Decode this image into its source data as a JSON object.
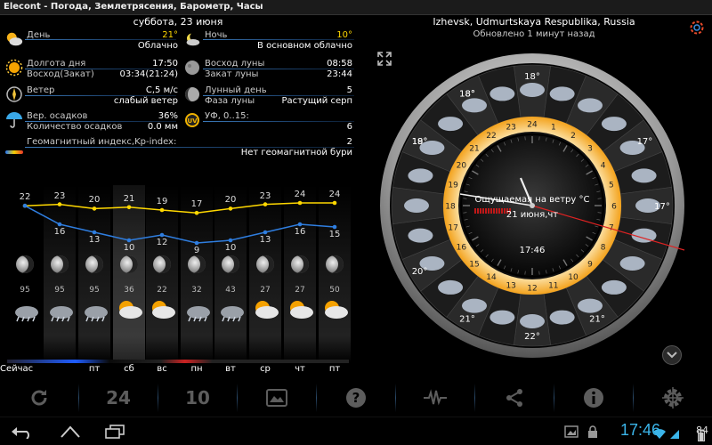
{
  "window": {
    "title": "Elecont - Погода, Землетрясения, Барометр, Часы"
  },
  "left": {
    "date": "суббота, 23 июня",
    "rows": [
      {
        "l_label": "День",
        "l_value": "21°",
        "l_sub": "Облачно",
        "r_label": "Ночь",
        "r_value": "10°",
        "r_sub": "В основном облачно"
      },
      {
        "l_label": "Долгота дня",
        "l_value": "17:50",
        "l_label2": "Восход(Закат)",
        "l_value2": "03:34(21:24)",
        "r_label": "Восход луны",
        "r_value": "08:58",
        "r_label2": "Закат луны",
        "r_value2": "23:44"
      },
      {
        "l_label": "Ветер",
        "l_value": "С,5 м/с",
        "l_sub": "слабый ветер",
        "r_label": "Лунный день",
        "r_value": "5",
        "r_label2": "Фаза луны",
        "r_value2": "Растущий серп"
      },
      {
        "l_label": "Вер. осадков",
        "l_value": "36%",
        "l_label2": "Количество осадков",
        "l_value2": "0.0 мм",
        "r_label": "УФ, 0..15:",
        "r_value2": "6"
      },
      {
        "l_label": "Геомагнитный индекс,Kp-index:",
        "l_value": "2",
        "l_sub": "Нет геомагнитной бури"
      }
    ]
  },
  "forecast": {
    "days": [
      "Сейчас",
      "",
      "пт",
      "сб",
      "вс",
      "пн",
      "вт",
      "ср",
      "чт",
      "пт"
    ],
    "highs": [
      "22",
      "23",
      "20",
      "21",
      "19",
      "17",
      "20",
      "23",
      "24",
      "24"
    ],
    "lows": [
      "",
      "16",
      "13",
      "10",
      "12",
      "9",
      "10",
      "13",
      "16",
      "15"
    ],
    "precip": [
      "95",
      "95",
      "95",
      "36",
      "22",
      "32",
      "43",
      "27",
      "27",
      "50"
    ],
    "icons": [
      "storm-cloud-icon",
      "storm-cloud-icon",
      "storm-cloud-icon",
      "sun-cloud-icon",
      "sun-cloud-icon",
      "storm-cloud-icon",
      "storm-cloud-icon",
      "sun-cloud-icon",
      "sun-cloud-icon",
      "sun-cloud-icon"
    ]
  },
  "right": {
    "location": "Izhevsk, Udmurtskaya Respublika, Russia",
    "updated": "Обновлено 1 минут назад",
    "dial": {
      "center_label": "Ощущаемая на ветру °C",
      "center_date": "21 июня,чт",
      "center_time": "17:46",
      "hours": [
        "24",
        "1",
        "2",
        "3",
        "4",
        "5",
        "6",
        "7",
        "8",
        "9",
        "10",
        "11",
        "12",
        "13",
        "14",
        "15",
        "16",
        "17",
        "18",
        "19",
        "20",
        "21",
        "22",
        "23"
      ],
      "outer_temps": [
        "18°",
        "18°",
        "18°",
        "17°",
        "17°",
        "21°",
        "22°",
        "21°",
        "20°",
        "19°",
        "18°"
      ]
    }
  },
  "toolbar": {
    "btn_24": "24",
    "btn_10": "10"
  },
  "status": {
    "clock": "17:46",
    "battery": "84"
  },
  "colors": {
    "accent": "#3bb5ea",
    "yellow": "#ffd800",
    "blue_line": "#2f7ee0"
  }
}
